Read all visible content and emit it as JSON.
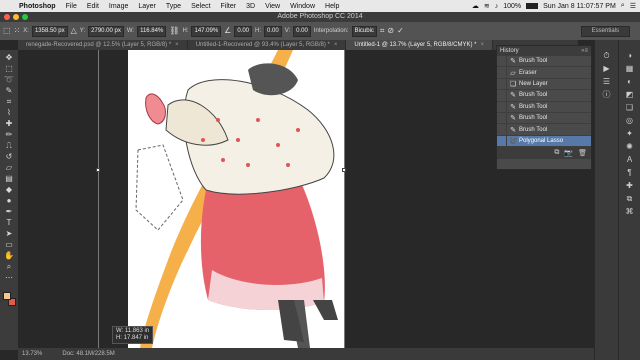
{
  "menubar": {
    "apple_icon": "apple-icon",
    "items": [
      "Photoshop",
      "File",
      "Edit",
      "Image",
      "Layer",
      "Type",
      "Select",
      "Filter",
      "3D",
      "View",
      "Window",
      "Help"
    ],
    "battery_percent": "100%",
    "clock": "Sun Jan 8  11:07:57 PM"
  },
  "window": {
    "title": "Adobe Photoshop CC 2014"
  },
  "options": {
    "x_label": "X:",
    "x_value": "1358.50 px",
    "y_label": "Y:",
    "y_value": "2790.00 px",
    "w_label": "W:",
    "w_value": "116.84%",
    "h_label": "H:",
    "h_value": "147.09%",
    "angle_value": "0.00",
    "hskew_label": "H:",
    "hskew_value": "0.00",
    "vskew_label": "V:",
    "vskew_value": "0.00",
    "interp_label": "Interpolation:",
    "interp_value": "Bicubic",
    "workspace": "Essentials"
  },
  "tabs": [
    {
      "label": "renegade-Recovered.psd @ 12.5% (Layer 5, RGB/8) *",
      "close": "×"
    },
    {
      "label": "Untitled-1-Recovered @ 93.4% (Layer 5, RGB/8) *",
      "close": "×"
    },
    {
      "label": "Untitled-1 @ 13.7% (Layer 5, RGB/8/CMYK) *",
      "close": "×"
    }
  ],
  "tooltip": {
    "w": "W: 11.863 in",
    "h": "H: 17.847 in"
  },
  "status": {
    "zoom": "13.73%",
    "doc": "Doc: 48.1M/228.5M"
  },
  "history": {
    "title": "History",
    "items": [
      {
        "icon": "brush-icon",
        "label": "Brush Tool"
      },
      {
        "icon": "eraser-icon",
        "label": "Eraser"
      },
      {
        "icon": "new-layer-icon",
        "label": "New Layer"
      },
      {
        "icon": "brush-icon",
        "label": "Brush Tool"
      },
      {
        "icon": "brush-icon",
        "label": "Brush Tool"
      },
      {
        "icon": "brush-icon",
        "label": "Brush Tool"
      },
      {
        "icon": "brush-icon",
        "label": "Brush Tool"
      },
      {
        "icon": "lasso-icon",
        "label": "Polygonal Lasso"
      }
    ],
    "selected_index": 7
  },
  "colors": {
    "foreground": "#f4c78f",
    "background": "#e05a4e",
    "selection": "#5679a8",
    "illustration_orange": "#f6b04a",
    "illustration_pink": "#e5626a"
  }
}
